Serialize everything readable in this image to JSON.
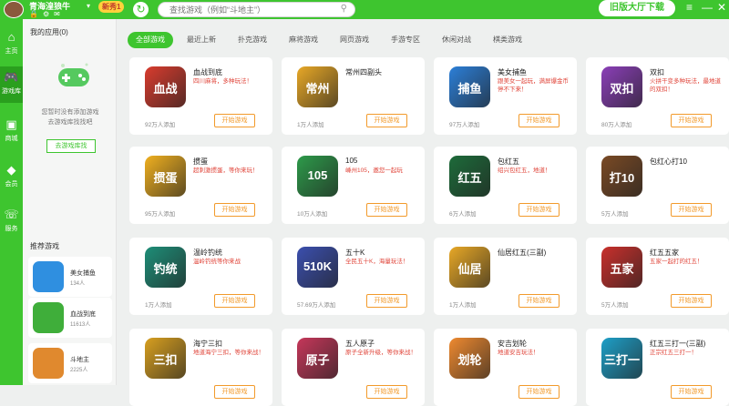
{
  "user": {
    "name": "青海湟狼牛",
    "vip": "VIP",
    "badge": "新秀1"
  },
  "search": {
    "placeholder": "查找游戏（例如“斗地主”）"
  },
  "header": {
    "download": "旧版大厅下载"
  },
  "nav": [
    {
      "label": "主页",
      "icon": "home-icon"
    },
    {
      "label": "游戏库",
      "icon": "gamepad-icon"
    },
    {
      "label": "商城",
      "icon": "shop-icon"
    },
    {
      "label": "会员",
      "icon": "vip-icon"
    },
    {
      "label": "服务",
      "icon": "headset-icon"
    }
  ],
  "my_apps": {
    "title": "我的应用(0)",
    "empty_line1": "您暂时没有添加游戏",
    "empty_line2": "去游戏库找找吧",
    "go_button": "去游戏库找",
    "recommend_title": "推荐游戏",
    "recommended": [
      {
        "name": "美女捕鱼",
        "count": "134人",
        "color": "#2f8fe0"
      },
      {
        "name": "血战到底",
        "count": "11613人",
        "color": "#3fae3a"
      },
      {
        "name": "斗地主",
        "count": "2225人",
        "color": "#e0892e"
      }
    ]
  },
  "tabs": [
    "全部游戏",
    "最近上新",
    "扑克游戏",
    "麻将游戏",
    "网页游戏",
    "手游专区",
    "休闲对战",
    "棋类游戏"
  ],
  "play_label": "开始游戏",
  "games": [
    {
      "name": "血战到底",
      "desc": "四川麻将，多种玩法！",
      "count": "92万人添加",
      "color": "#d93c2e",
      "icon_text": "血战"
    },
    {
      "name": "常州四副头",
      "desc": "",
      "count": "1万人添加",
      "color": "#e8a826",
      "icon_text": "常州"
    },
    {
      "name": "美女捕鱼",
      "desc": "跟美女一起玩，满屏爆金币停不下来！",
      "count": "97万人添加",
      "color": "#2c7fd8",
      "icon_text": "捕鱼"
    },
    {
      "name": "双扣",
      "desc": "火拼干变多种玩法，最地道的双扣！",
      "count": "80万人添加",
      "color": "#8b3fb8",
      "icon_text": "双扣"
    },
    {
      "name": "掼蛋",
      "desc": "超刺激掼蛋，等你来玩！",
      "count": "95万人添加",
      "color": "#f0b020",
      "icon_text": "掼蛋"
    },
    {
      "name": "105",
      "desc": "嵊州105，邀您一起玩",
      "count": "10万人添加",
      "color": "#2d9a4a",
      "icon_text": "105"
    },
    {
      "name": "包红五",
      "desc": "绍兴包红五，地道！",
      "count": "6万人添加",
      "color": "#1d6b3a",
      "icon_text": "红五"
    },
    {
      "name": "包红心打10",
      "desc": "",
      "count": "5万人添加",
      "color": "#7a4a25",
      "icon_text": "打10"
    },
    {
      "name": "温岭钓统",
      "desc": "温岭钓统等你来战",
      "count": "1万人添加",
      "color": "#1e8e78",
      "icon_text": "钓统"
    },
    {
      "name": "五十K",
      "desc": "全民五十K，海量玩法！",
      "count": "57.69万人添加",
      "color": "#3b4fae",
      "icon_text": "510K"
    },
    {
      "name": "仙居红五(三副)",
      "desc": "",
      "count": "1万人添加",
      "color": "#e8a826",
      "icon_text": "仙居"
    },
    {
      "name": "红五五家",
      "desc": "五家一起打的红五！",
      "count": "5万人添加",
      "color": "#c9302c",
      "icon_text": "五家"
    },
    {
      "name": "海宁三扣",
      "desc": "地道海宁三扣，等你来战！",
      "count": "",
      "color": "#d8a020",
      "icon_text": "三扣"
    },
    {
      "name": "五人原子",
      "desc": "原子全新升级，等你来战！",
      "count": "",
      "color": "#c6375a",
      "icon_text": "原子"
    },
    {
      "name": "安吉划轮",
      "desc": "地道安吉玩法！",
      "count": "",
      "color": "#ef8a30",
      "icon_text": "划轮"
    },
    {
      "name": "红五三打一(三副)",
      "desc": "正宗红五三打一！",
      "count": "",
      "color": "#1ea0c8",
      "icon_text": "三打一"
    }
  ]
}
